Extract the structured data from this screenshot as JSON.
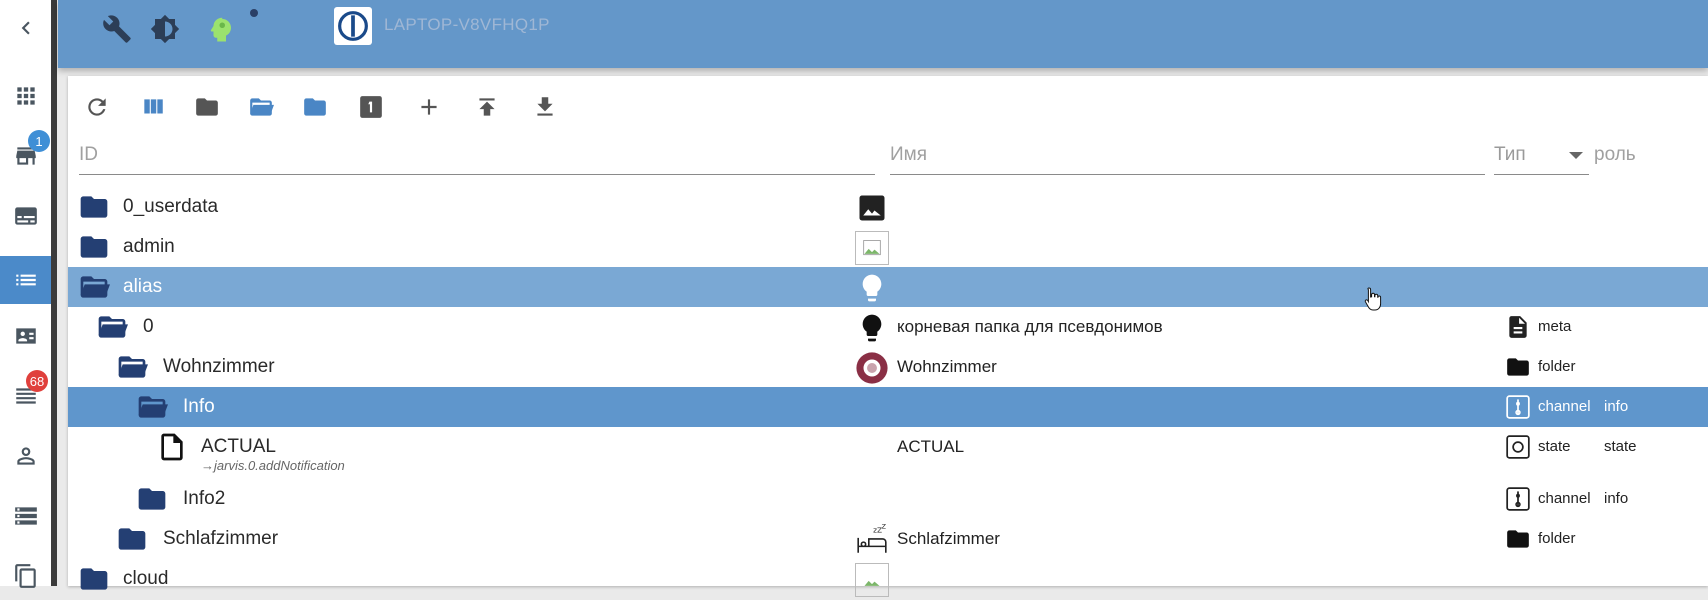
{
  "header": {
    "hostname": "LAPTOP-V8VFHQ1P",
    "icons": [
      "wrench-icon",
      "brightness-icon",
      "expert-mode-icon",
      "iobroker-logo"
    ]
  },
  "sidebar": {
    "items": [
      {
        "name": "collapse-icon"
      },
      {
        "name": "apps-icon"
      },
      {
        "name": "adapters-icon",
        "badge": "1"
      },
      {
        "name": "instances-icon"
      },
      {
        "name": "objects-icon",
        "active": true
      },
      {
        "name": "enums-icon"
      },
      {
        "name": "logs-icon",
        "badge": "68"
      },
      {
        "name": "users-icon"
      },
      {
        "name": "hosts-icon"
      },
      {
        "name": "files-icon"
      }
    ]
  },
  "toolbar": {
    "buttons": [
      "refresh",
      "columns",
      "collapse-all",
      "expand",
      "folder",
      "one-level",
      "add",
      "upload",
      "download"
    ]
  },
  "filters": {
    "id_placeholder": "ID",
    "name_placeholder": "Имя",
    "type_placeholder": "Тип",
    "role_placeholder": "роль"
  },
  "rows": [
    {
      "id": "0_userdata",
      "name": "",
      "type": "",
      "role": ""
    },
    {
      "id": "admin",
      "name": "",
      "type": "",
      "role": ""
    },
    {
      "id": "alias",
      "name": "",
      "type": "",
      "role": ""
    },
    {
      "id": "0",
      "name": "корневая папка для псевдонимов",
      "type": "meta",
      "role": ""
    },
    {
      "id": "Wohnzimmer",
      "name": "Wohnzimmer",
      "type": "folder",
      "role": ""
    },
    {
      "id": "Info",
      "name": "",
      "type": "channel",
      "role": "info"
    },
    {
      "id": "ACTUAL",
      "alias": "→jarvis.0.addNotification",
      "name": "ACTUAL",
      "type": "state",
      "role": "state"
    },
    {
      "id": "Info2",
      "name": "",
      "type": "channel",
      "role": "info"
    },
    {
      "id": "Schlafzimmer",
      "name": "Schlafzimmer",
      "type": "folder",
      "role": ""
    },
    {
      "id": "cloud",
      "name": "",
      "type": "",
      "role": ""
    }
  ],
  "colors": {
    "header": "#6497c9",
    "selected_row": "#5f96cc",
    "hover_row": "#7aa8d4",
    "folder": "#243f73"
  }
}
